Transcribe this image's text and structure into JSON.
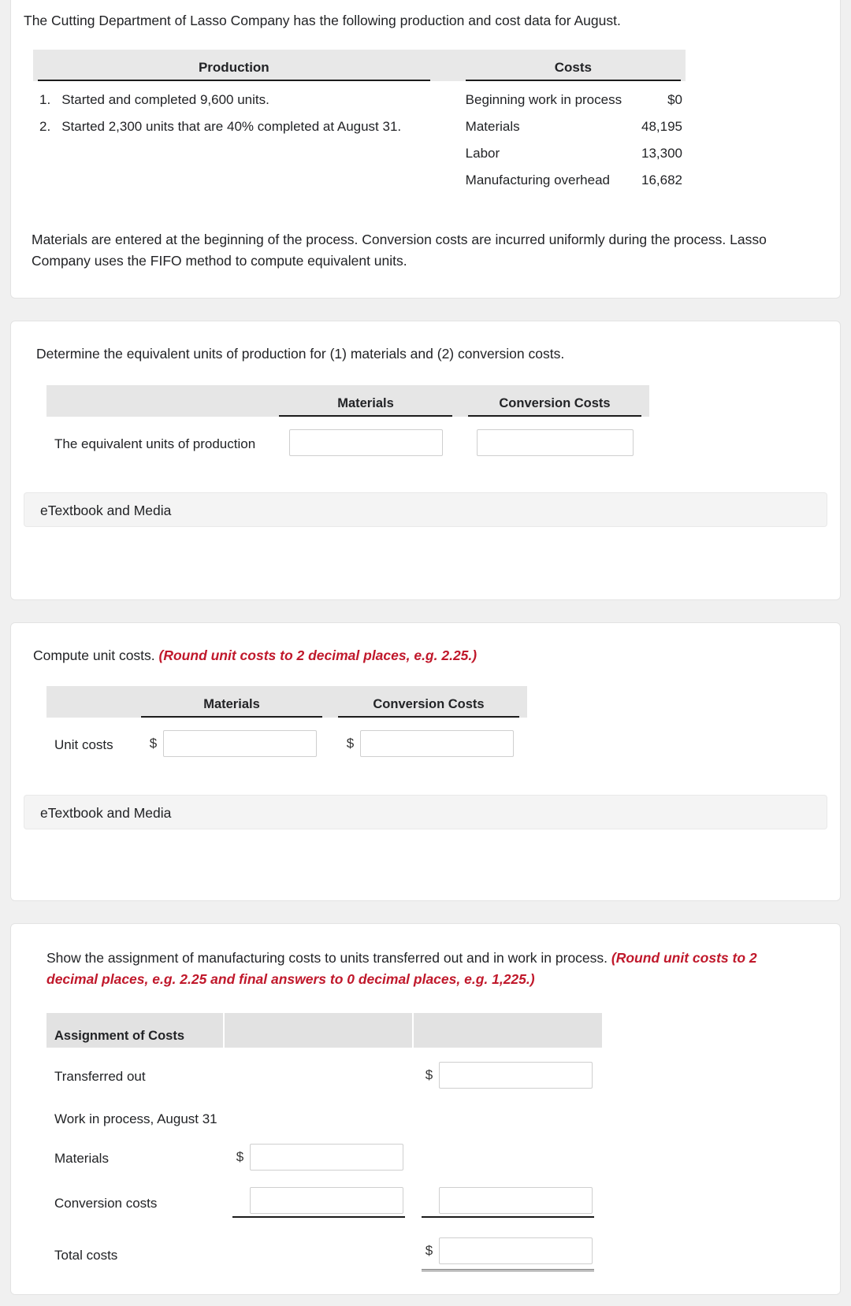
{
  "problem": {
    "intro": "The Cutting Department of Lasso Company has the following production and cost data for August.",
    "table": {
      "headers": {
        "production": "Production",
        "costs": "Costs"
      },
      "production_items": [
        {
          "num": "1.",
          "text": "Started and completed 9,600 units."
        },
        {
          "num": "2.",
          "text": "Started 2,300 units that are 40% completed at August 31."
        }
      ],
      "cost_items": [
        {
          "label": "Beginning work in process",
          "value": "$0"
        },
        {
          "label": "Materials",
          "value": "48,195"
        },
        {
          "label": "Labor",
          "value": "13,300"
        },
        {
          "label": "Manufacturing overhead",
          "value": "16,682"
        }
      ]
    },
    "note": "Materials are entered at the beginning of the process. Conversion costs are incurred uniformly during the process. Lasso Company uses the FIFO method to compute equivalent units."
  },
  "part1": {
    "prompt": "Determine the equivalent units of production for (1) materials and (2) conversion costs.",
    "columns": {
      "blank": "",
      "materials": "Materials",
      "conversion": "Conversion Costs"
    },
    "row_label": "The equivalent units of production",
    "materials_value": "",
    "conversion_value": "",
    "etextbook_label": "eTextbook and Media"
  },
  "part2": {
    "prompt_text": "Compute unit costs. ",
    "prompt_note": "(Round unit costs to 2 decimal places, e.g. 2.25.)",
    "columns": {
      "blank": "",
      "materials": "Materials",
      "conversion": "Conversion Costs"
    },
    "row_label": "Unit costs",
    "currency_symbol": "$",
    "materials_value": "",
    "conversion_value": "",
    "etextbook_label": "eTextbook and Media"
  },
  "part3": {
    "prompt_text": "Show the assignment of manufacturing costs to units transferred out and in work in process. ",
    "prompt_note": "(Round unit costs to 2 decimal places, e.g. 2.25 and final answers to 0 decimal places, e.g. 1,225.)",
    "table_title": "Assignment of Costs",
    "currency_symbol": "$",
    "rows": {
      "transferred_out": "Transferred out",
      "wip_header": "Work in process, August 31",
      "materials": "Materials",
      "conversion_costs": "Conversion costs",
      "total_costs": "Total costs"
    },
    "values": {
      "transferred_out": "",
      "materials": "",
      "conversion_mid": "",
      "conversion_right": "",
      "total_costs": ""
    }
  },
  "annotation": {
    "pen_color": "#1c51d6",
    "pen_name": "blue-pen-stroke"
  },
  "colors": {
    "page_bg": "#f0f0f0",
    "card_bg": "#ffffff",
    "header_band": "#e6e6e6",
    "accent_red": "#c0182b"
  }
}
